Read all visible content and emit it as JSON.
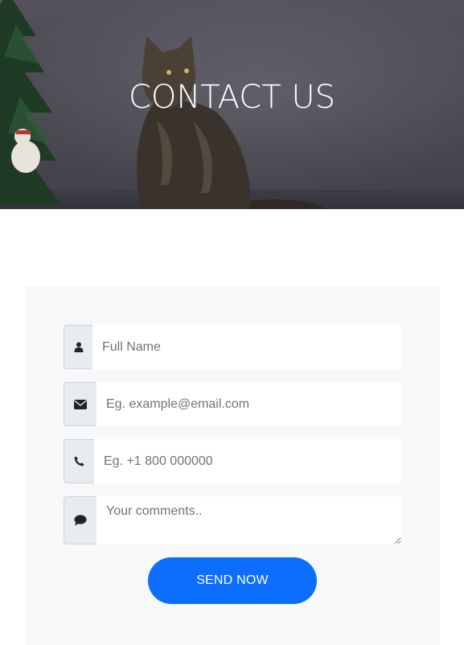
{
  "hero": {
    "title": "CONTACT US"
  },
  "form": {
    "name": {
      "icon": "user-icon",
      "placeholder": "Full Name",
      "value": ""
    },
    "email": {
      "icon": "envelope-icon",
      "placeholder": "Eg. example@email.com",
      "value": ""
    },
    "phone": {
      "icon": "phone-icon",
      "placeholder": "Eg. +1 800 000000",
      "value": ""
    },
    "comments": {
      "icon": "comment-icon",
      "placeholder": "Your comments..",
      "value": ""
    },
    "submit_label": "SEND NOW"
  },
  "colors": {
    "accent": "#0d6efd",
    "card_background": "#f7f8fa",
    "addon_background": "#e9ecef"
  }
}
